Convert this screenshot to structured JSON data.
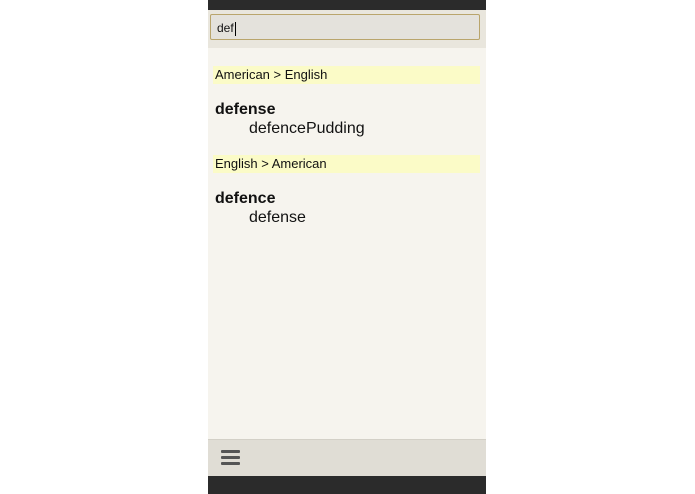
{
  "search": {
    "value": "def"
  },
  "sections": [
    {
      "header": "American > English",
      "entries": [
        {
          "term": "defense",
          "definition": "defencePudding"
        }
      ]
    },
    {
      "header": "English > American",
      "entries": [
        {
          "term": "defence",
          "definition": "defense"
        }
      ]
    }
  ],
  "bottom_bar": {
    "menu_icon": "hamburger-menu-icon"
  },
  "colors": {
    "section_header_bg": "#fbfbc7",
    "background": "#f6f4ee",
    "search_border": "#b9a56c"
  }
}
